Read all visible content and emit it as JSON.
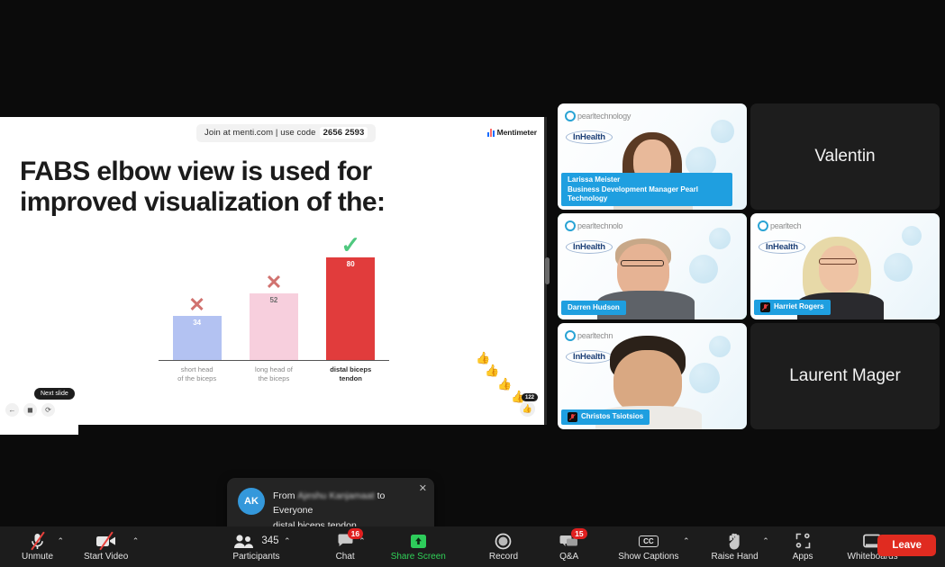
{
  "share": {
    "menti": {
      "join_text": "Join at menti.com | use code",
      "join_code": "2656 2593",
      "brand": "Mentimeter",
      "question": "FABS elbow view is used for improved visualization of the:"
    },
    "slide_controls": {
      "back_icon": "arrow-left-icon",
      "stop_icon": "stop-square-icon",
      "refresh_icon": "refresh-icon",
      "tooltip": "Next slide"
    },
    "reactions": {
      "count": "122",
      "button_icon": "thumbs-up-icon"
    }
  },
  "chart_data": {
    "type": "bar",
    "title": "FABS elbow view is used for improved visualization of the:",
    "categories": [
      "short head of the biceps",
      "long head of the biceps",
      "distal biceps tendon"
    ],
    "category_lines": [
      [
        "short head",
        "of the biceps"
      ],
      [
        "long head of",
        "the biceps"
      ],
      [
        "distal biceps",
        "tendon"
      ]
    ],
    "values": [
      34,
      52,
      80
    ],
    "markers": [
      "✕",
      "✕",
      "✓"
    ],
    "marker_types": [
      "wrong",
      "wrong",
      "correct"
    ],
    "colors": [
      "#b3c2f2",
      "#f7cfdd",
      "#e13c3c"
    ],
    "marker_colors": [
      "#d1726f",
      "#d1726f",
      "#4fc87f"
    ],
    "xlabel": "",
    "ylabel": "",
    "ylim": [
      0,
      100
    ],
    "grid": false,
    "legend": false
  },
  "tiles": [
    {
      "id": "larissa",
      "name": "Larissa Meister",
      "subtitle": "Business Development Manager Pearl Technology",
      "type": "video",
      "muted": false,
      "active_speaker": false,
      "logo_primary": "pearl",
      "logo_primary_text": "pearltechnology",
      "logo_secondary": "InHealth"
    },
    {
      "id": "valentin",
      "name": "Valentin",
      "type": "name-only",
      "muted": false,
      "active_speaker": false
    },
    {
      "id": "darren",
      "name": "Darren Hudson",
      "subtitle": "",
      "type": "video",
      "muted": false,
      "active_speaker": true,
      "logo_primary_text": "pearltechnolo",
      "logo_secondary": "InHealth"
    },
    {
      "id": "harriet",
      "name": "Harriet Rogers",
      "subtitle": "",
      "type": "video",
      "muted": true,
      "active_speaker": false,
      "logo_primary_text": "pearltech",
      "logo_secondary": "InHealth"
    },
    {
      "id": "christos",
      "name": "Christos Tsiotsios",
      "subtitle": "",
      "type": "video",
      "muted": true,
      "active_speaker": false,
      "logo_primary_text": "pearltechn",
      "logo_secondary": "InHealth"
    },
    {
      "id": "laurent",
      "name": "Laurent Mager",
      "type": "name-only",
      "muted": false,
      "active_speaker": false
    }
  ],
  "chat_toast": {
    "avatar_initials": "AK",
    "from_prefix": "From",
    "sender_blurred": "Ajeshu Kanjamaat",
    "to_text": "to Everyone",
    "message": "distal biceps tendon",
    "close_icon": "close-icon"
  },
  "toolbar": {
    "items": [
      {
        "id": "mute",
        "label": "Unmute",
        "icon": "microphone-muted-icon",
        "caret": true,
        "badge": "",
        "green": false
      },
      {
        "id": "video",
        "label": "Start Video",
        "icon": "camera-muted-icon",
        "caret": true,
        "badge": "",
        "green": false
      },
      {
        "id": "participants",
        "label": "Participants",
        "icon": "people-icon",
        "caret": true,
        "badge": "",
        "green": false,
        "count": "345"
      },
      {
        "id": "chat",
        "label": "Chat",
        "icon": "chat-bubble-icon",
        "caret": true,
        "badge": "16",
        "green": false
      },
      {
        "id": "share",
        "label": "Share Screen",
        "icon": "share-screen-icon",
        "caret": false,
        "badge": "",
        "green": true
      },
      {
        "id": "record",
        "label": "Record",
        "icon": "record-circle-icon",
        "caret": false,
        "badge": "",
        "green": false
      },
      {
        "id": "qa",
        "label": "Q&A",
        "icon": "qa-bubbles-icon",
        "caret": false,
        "badge": "15",
        "green": false
      },
      {
        "id": "captions",
        "label": "Show Captions",
        "icon": "cc-icon",
        "caret": true,
        "badge": "",
        "green": false
      },
      {
        "id": "raisehand",
        "label": "Raise Hand",
        "icon": "raised-hand-icon",
        "caret": true,
        "badge": "",
        "green": false
      },
      {
        "id": "apps",
        "label": "Apps",
        "icon": "apps-icon",
        "caret": false,
        "badge": "",
        "green": false
      },
      {
        "id": "whiteboards",
        "label": "Whiteboards",
        "icon": "whiteboard-icon",
        "caret": false,
        "badge": "",
        "green": false
      }
    ],
    "leave_label": "Leave",
    "participants_count": "345"
  }
}
